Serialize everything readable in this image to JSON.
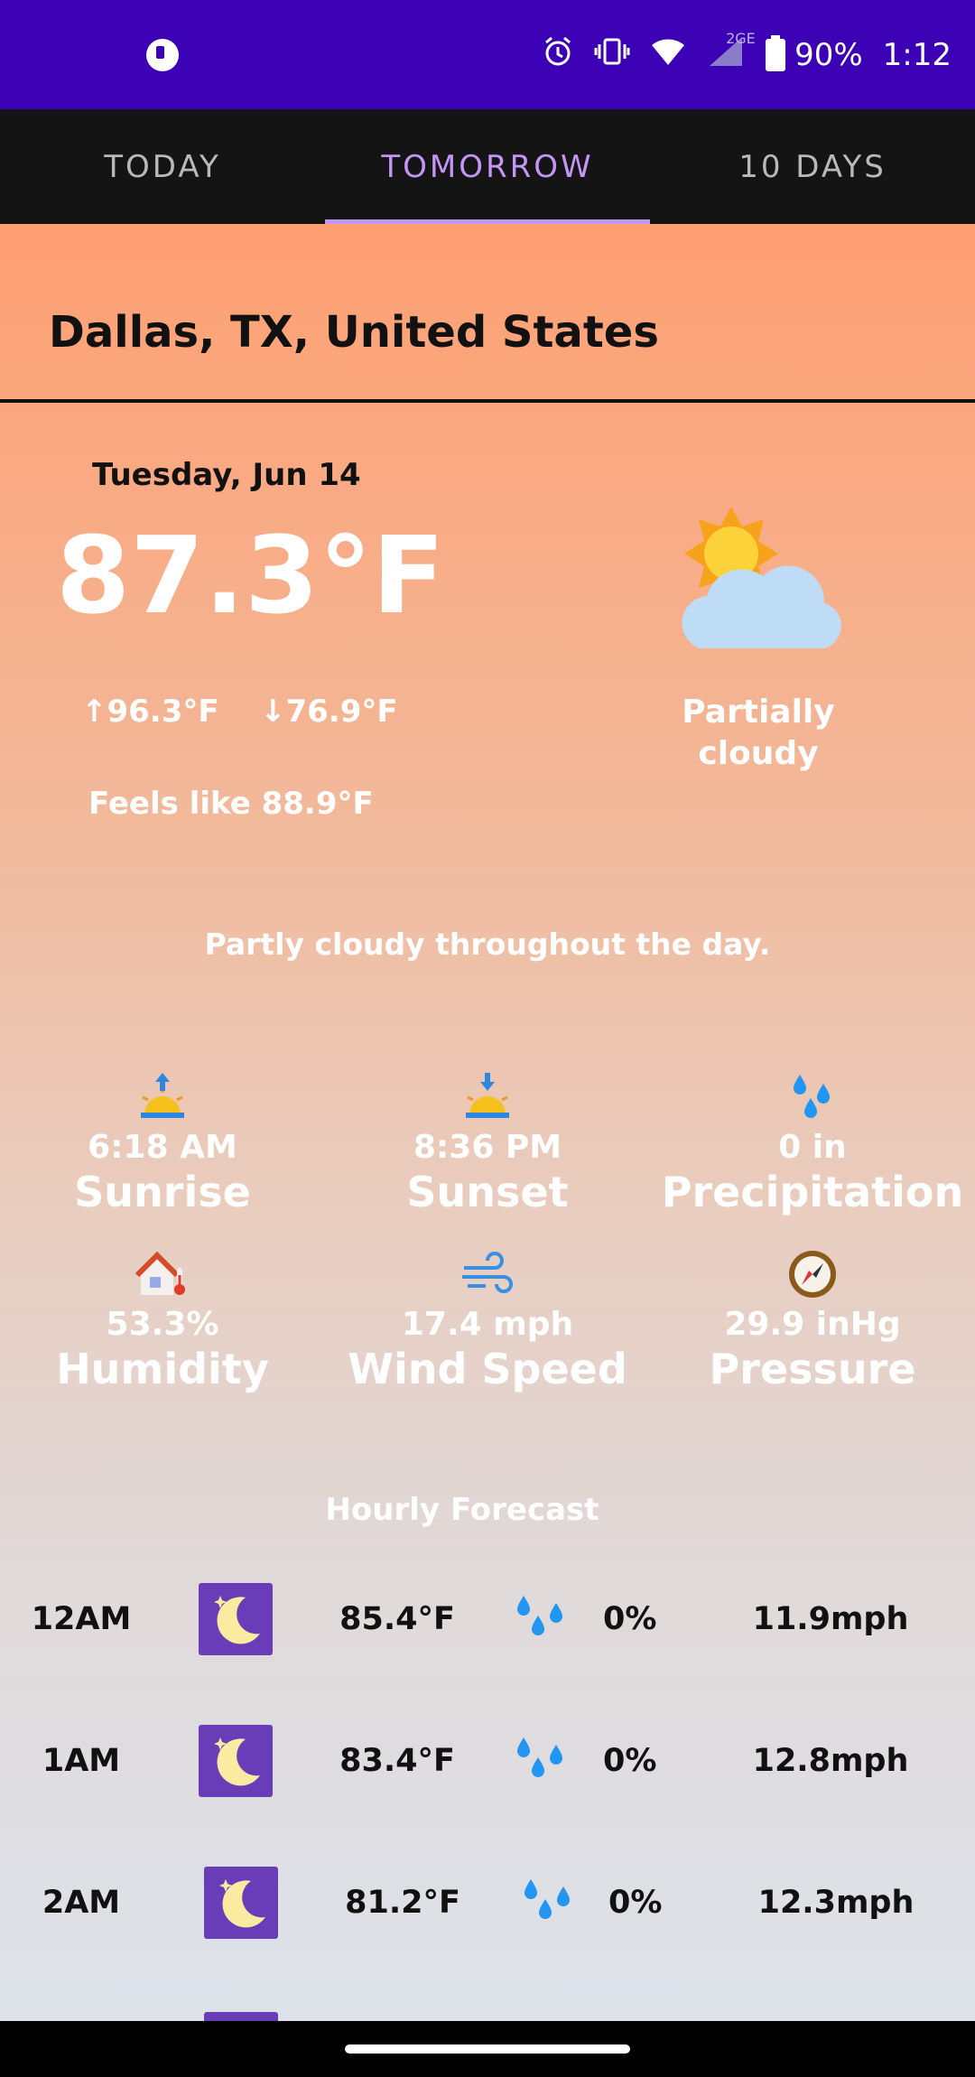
{
  "status_bar": {
    "battery": "90%",
    "time": "1:12",
    "network": "2GE"
  },
  "tabs": [
    {
      "label": "TODAY"
    },
    {
      "label": "TOMORROW"
    },
    {
      "label": "10 DAYS"
    }
  ],
  "active_tab": "TOMORROW",
  "location": "Dallas, TX, United States",
  "forecast": {
    "date": "Tuesday, Jun 14",
    "temperature": "87.3°F",
    "high": "↑96.3°F",
    "low": "↓76.9°F",
    "feels_like": "Feels like 88.9°F",
    "condition": "Partially cloudy",
    "condition_icon": "partly-cloudy-icon",
    "summary": "Partly cloudy throughout the day."
  },
  "stats": [
    {
      "icon": "sunrise-icon",
      "value": "6:18 AM",
      "label": "Sunrise"
    },
    {
      "icon": "sunset-icon",
      "value": "8:36 PM",
      "label": "Sunset"
    },
    {
      "icon": "raindrops-icon",
      "value": "0 in",
      "label": "Precipitation"
    },
    {
      "icon": "house-thermometer-icon",
      "value": "53.3%",
      "label": "Humidity"
    },
    {
      "icon": "wind-icon",
      "value": "17.4 mph",
      "label": "Wind Speed"
    },
    {
      "icon": "compass-icon",
      "value": "29.9 inHg",
      "label": "Pressure"
    }
  ],
  "hourly": {
    "title": "Hourly Forecast",
    "rows": [
      {
        "time": "12AM",
        "icon": "moon-icon",
        "temp": "85.4°F",
        "precip": "0%",
        "wind": "11.9mph"
      },
      {
        "time": "1AM",
        "icon": "moon-icon",
        "temp": "83.4°F",
        "precip": "0%",
        "wind": "12.8mph"
      },
      {
        "time": "2AM",
        "icon": "moon-icon",
        "temp": "81.2°F",
        "precip": "0%",
        "wind": "12.3mph"
      }
    ]
  },
  "colors": {
    "status_bar": "#3c00b5",
    "tab_bar": "#141414",
    "tab_active": "#c495f6",
    "gradient_top": "#ff9f72",
    "gradient_bottom": "#dde2ea",
    "moon_tile": "#6a3db8",
    "drop_blue": "#2196f3"
  }
}
